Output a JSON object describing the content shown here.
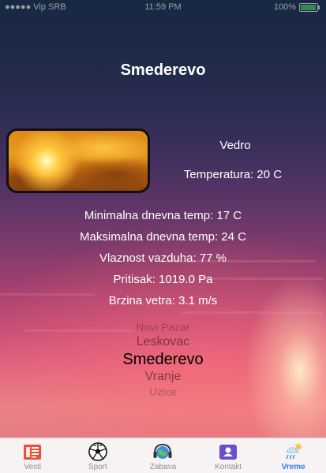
{
  "status_bar": {
    "carrier": "●●●●● Vip SRB",
    "time": "11:59 PM",
    "battery": "100%"
  },
  "city": "Smederevo",
  "condition": "Vedro",
  "temperature": "Temperatura: 20 C",
  "details": [
    "Minimalna dnevna temp: 17 C",
    "Maksimalna dnevna temp: 24 C",
    "Vlaznost vazduha: 77 %",
    "Pritisak: 1019.0 Pa",
    "Brzina vetra: 3.1 m/s"
  ],
  "picker": {
    "items": [
      "Novi Pazar",
      "Leskovac",
      "Smederevo",
      "Vranje",
      "Uzice"
    ],
    "selected": "Smederevo"
  },
  "tabs": [
    {
      "label": "Vesti",
      "icon": "news-icon"
    },
    {
      "label": "Sport",
      "icon": "soccer-ball-icon"
    },
    {
      "label": "Zabava",
      "icon": "headphones-globe-icon"
    },
    {
      "label": "Kontakt",
      "icon": "contact-card-icon"
    },
    {
      "label": "Vreme",
      "icon": "weather-icon",
      "active": true
    }
  ],
  "colors": {
    "accent": "#2d7ff9",
    "tab_inactive": "#8e8e93",
    "news_icon": "#e8503a",
    "contact_icon": "#6b4fc8"
  }
}
